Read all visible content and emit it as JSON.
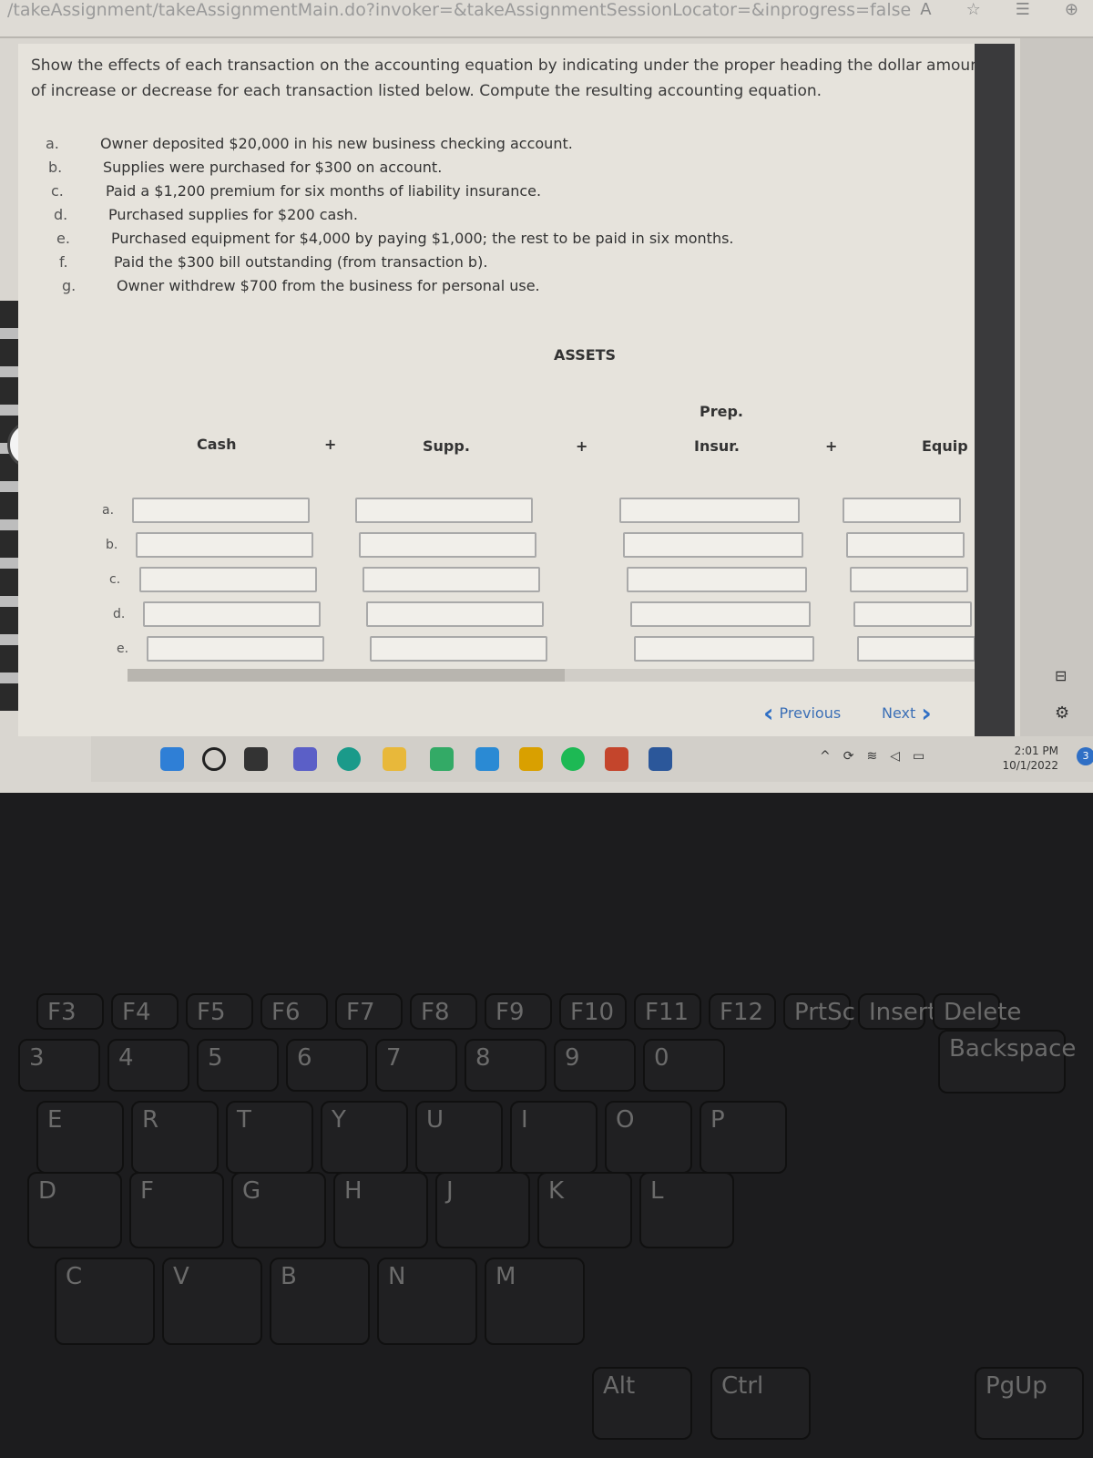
{
  "browser": {
    "url": "/takeAssignment/takeAssignmentMain.do?invoker=&takeAssignmentSessionLocator=&inprogress=false",
    "icons": [
      "read-aloud-icon",
      "favorites-add-icon",
      "favorites-icon",
      "collections-icon"
    ]
  },
  "instructions": "Show the effects of each transaction on the accounting equation by indicating under the proper heading the dollar amount of increase or decrease for each transaction listed below. Compute the resulting accounting equation.",
  "transactions": [
    {
      "letter": "a.",
      "text": "Owner deposited $20,000 in his new business checking account."
    },
    {
      "letter": "b.",
      "text": "Supplies were purchased for $300 on account."
    },
    {
      "letter": "c.",
      "text": "Paid a $1,200 premium for six months of liability insurance."
    },
    {
      "letter": "d.",
      "text": "Purchased supplies for $200 cash."
    },
    {
      "letter": "e.",
      "text": "Purchased equipment for $4,000 by paying $1,000; the rest to be paid in six months."
    },
    {
      "letter": "f.",
      "text": "Paid the $300 bill outstanding (from transaction b)."
    },
    {
      "letter": "g.",
      "text": "Owner withdrew $700 from the business for personal use."
    }
  ],
  "table": {
    "group": "ASSETS",
    "columns": [
      "Cash",
      "+",
      "Supp.",
      "+",
      "Prep.",
      "Insur.",
      "+",
      "Equip"
    ],
    "rows": [
      "a.",
      "b.",
      "c.",
      "d.",
      "e."
    ],
    "values": [
      [
        "",
        "",
        "",
        ""
      ],
      [
        "",
        "",
        "",
        ""
      ],
      [
        "",
        "",
        "",
        ""
      ],
      [
        "",
        "",
        "",
        ""
      ],
      [
        "",
        "",
        "",
        ""
      ]
    ]
  },
  "nav": {
    "previous": "Previous",
    "next": "Next"
  },
  "taskbar": {
    "time": "2:01 PM",
    "date": "10/1/2022",
    "notifications": "3"
  },
  "keyboard": {
    "fn": [
      "F3",
      "F4",
      "F5",
      "F6",
      "F7",
      "F8",
      "F9",
      "F10",
      "F11",
      "F12",
      "PrtSc",
      "Insert",
      "Delete"
    ],
    "numbers": [
      "3",
      "4",
      "5",
      "6",
      "7",
      "8",
      "9",
      "0"
    ],
    "top": [
      "E",
      "R",
      "T",
      "Y",
      "U",
      "I",
      "O",
      "P"
    ],
    "home": [
      "D",
      "F",
      "G",
      "H",
      "J",
      "K",
      "L"
    ],
    "bottom": [
      "C",
      "V",
      "B",
      "N",
      "M"
    ],
    "other": [
      "Backspace",
      "Alt",
      "Ctrl",
      "PgUp"
    ]
  }
}
